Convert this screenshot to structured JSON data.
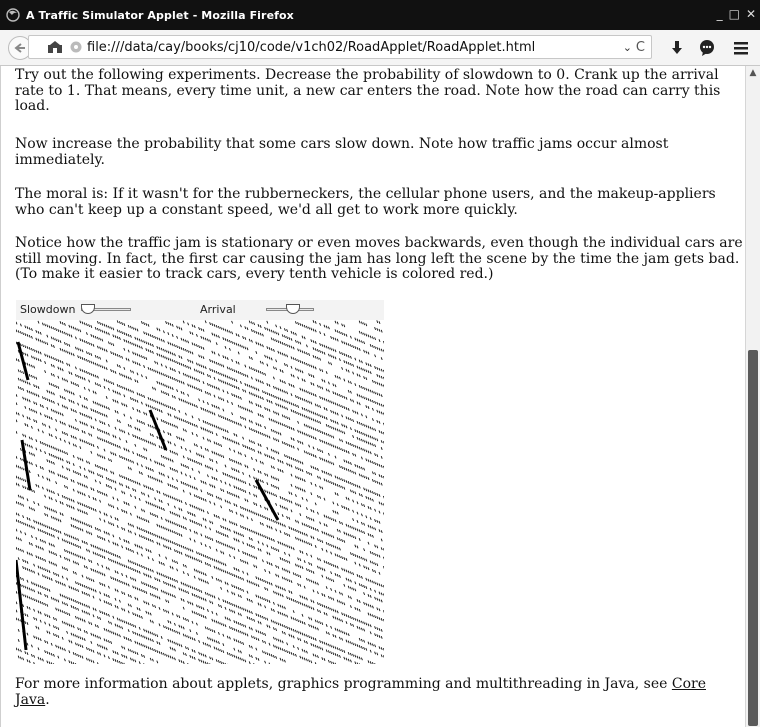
{
  "window": {
    "title": "A Traffic Simulator Applet - Mozilla Firefox"
  },
  "toolbar": {
    "url": "file:///data/cay/books/cj10/code/v1ch02/RoadApplet/RoadApplet.html",
    "dropdown_glyph": "⌄",
    "reload_glyph": "C"
  },
  "page": {
    "paragraphs": [
      "Try out the following experiments. Decrease the probability of slowdown to 0. Crank up the arrival rate to 1. That means, every time unit, a new car enters the road. Note how the road can carry this load.",
      "Now increase the probability that some cars slow down. Note how traffic jams occur almost immediately.",
      "The moral is: If it wasn't for the rubberneckers, the cellular phone users, and the makeup-appliers who can't keep up a constant speed, we'd all get to work more quickly.",
      "Notice how the traffic jam is stationary or even moves backwards, even though the individual cars are still moving. In fact, the first car causing the jam has long left the scene by the time the jam gets bad. (To make it easier to track cars, every tenth vehicle is colored red.)"
    ],
    "footer_text": "For more information about applets, graphics programming and multithreading in Java, see ",
    "footer_link": "Core Java",
    "footer_end": "."
  },
  "applet": {
    "slowdown_label": "Slowdown",
    "arrival_label": "Arrival",
    "slowdown_value": 0.0,
    "arrival_value": 0.6
  },
  "icons": [
    "back-arrow-icon",
    "firefox-icon",
    "identity-icon",
    "page-icon",
    "dropdown-icon",
    "reload-icon",
    "download-icon",
    "chat-icon",
    "menu-icon"
  ]
}
